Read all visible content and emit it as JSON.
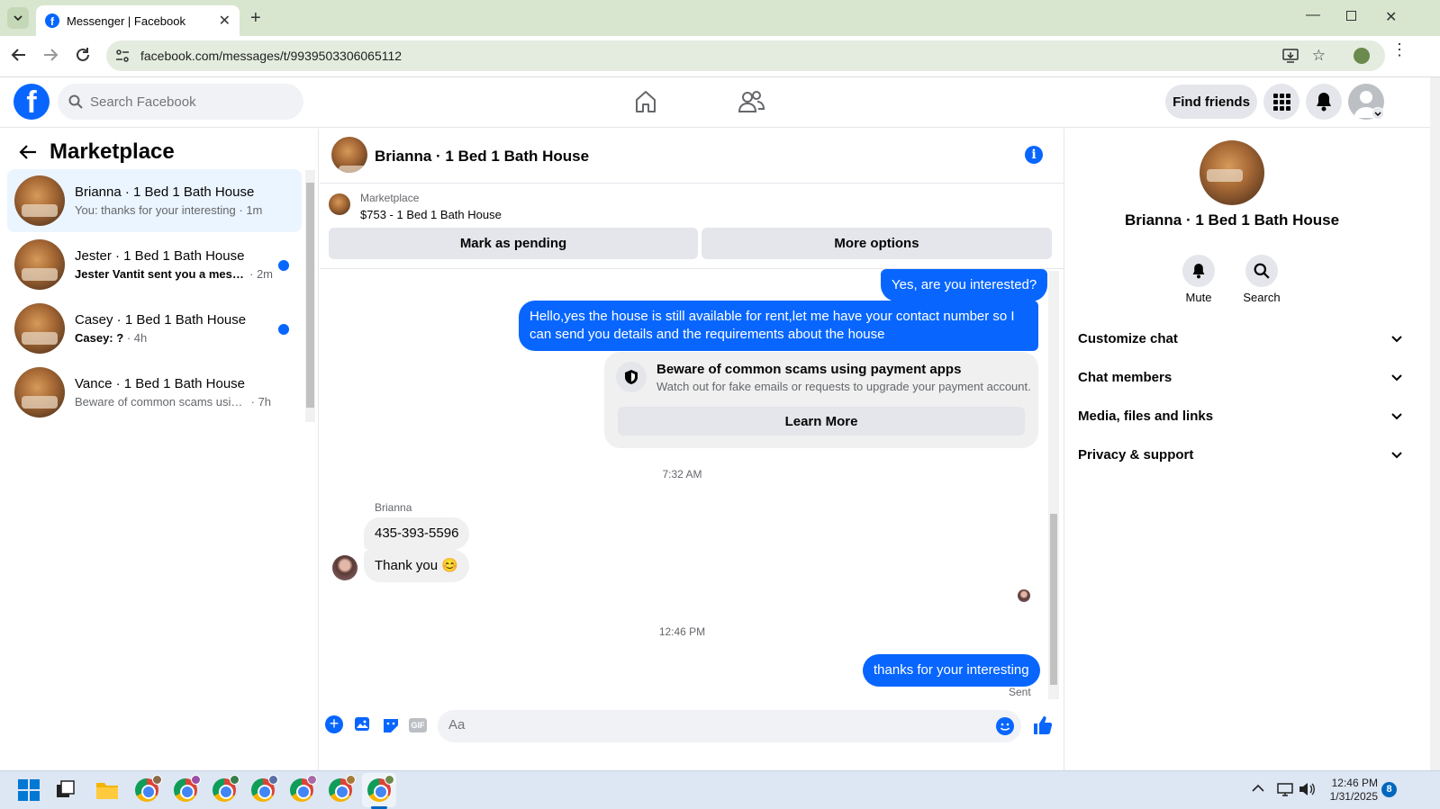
{
  "browser": {
    "tab_title": "Messenger | Facebook",
    "url": "facebook.com/messages/t/9939503306065112"
  },
  "header": {
    "search_placeholder": "Search Facebook",
    "find_friends": "Find friends"
  },
  "sidebar": {
    "title": "Marketplace",
    "conversations": [
      {
        "name": "Brianna · 1 Bed 1 Bath House",
        "preview": "You: thanks for your interesting",
        "time": "· 1m",
        "unread": false,
        "selected": true
      },
      {
        "name": "Jester · 1 Bed 1 Bath House",
        "preview": "Jester Vantit sent you a messag...",
        "time": "· 2m",
        "unread": true,
        "selected": false
      },
      {
        "name": "Casey · 1 Bed 1 Bath House",
        "preview": "Casey: ?",
        "time": "· 4h",
        "unread": true,
        "selected": false
      },
      {
        "name": "Vance · 1 Bed 1 Bath House",
        "preview": "Beware of common scams using p...",
        "time": "· 7h",
        "unread": false,
        "selected": false
      }
    ]
  },
  "chat": {
    "title": "Brianna · 1 Bed 1 Bath House",
    "listing": {
      "label": "Marketplace",
      "price_title": "$753 - 1 Bed 1 Bath House",
      "mark_pending": "Mark as pending",
      "more_options": "More options"
    },
    "messages": {
      "out1": "Yes, are you interested?",
      "out2": "Hello,yes the house is still available for rent,let me have your contact number   so I can send you details and the requirements about the house",
      "scam_title": "Beware of common scams using payment apps",
      "scam_body": "Watch out for fake emails or requests to upgrade your payment account.",
      "learn_more": "Learn More",
      "time1": "7:32 AM",
      "sender": "Brianna",
      "in1": "435-393-5596",
      "in2": "Thank you 😊",
      "time2": "12:46 PM",
      "out3": "thanks for your interesting",
      "status": "Sent"
    },
    "composer_placeholder": "Aa"
  },
  "details": {
    "name": "Brianna · 1 Bed 1 Bath House",
    "mute": "Mute",
    "search": "Search",
    "sections": [
      "Customize chat",
      "Chat members",
      "Media, files and links",
      "Privacy & support"
    ]
  },
  "taskbar": {
    "time": "12:46 PM",
    "date": "1/31/2025",
    "badge": "8"
  },
  "colors": {
    "accent": "#0866ff",
    "tabbar": "#d9e6cf"
  }
}
